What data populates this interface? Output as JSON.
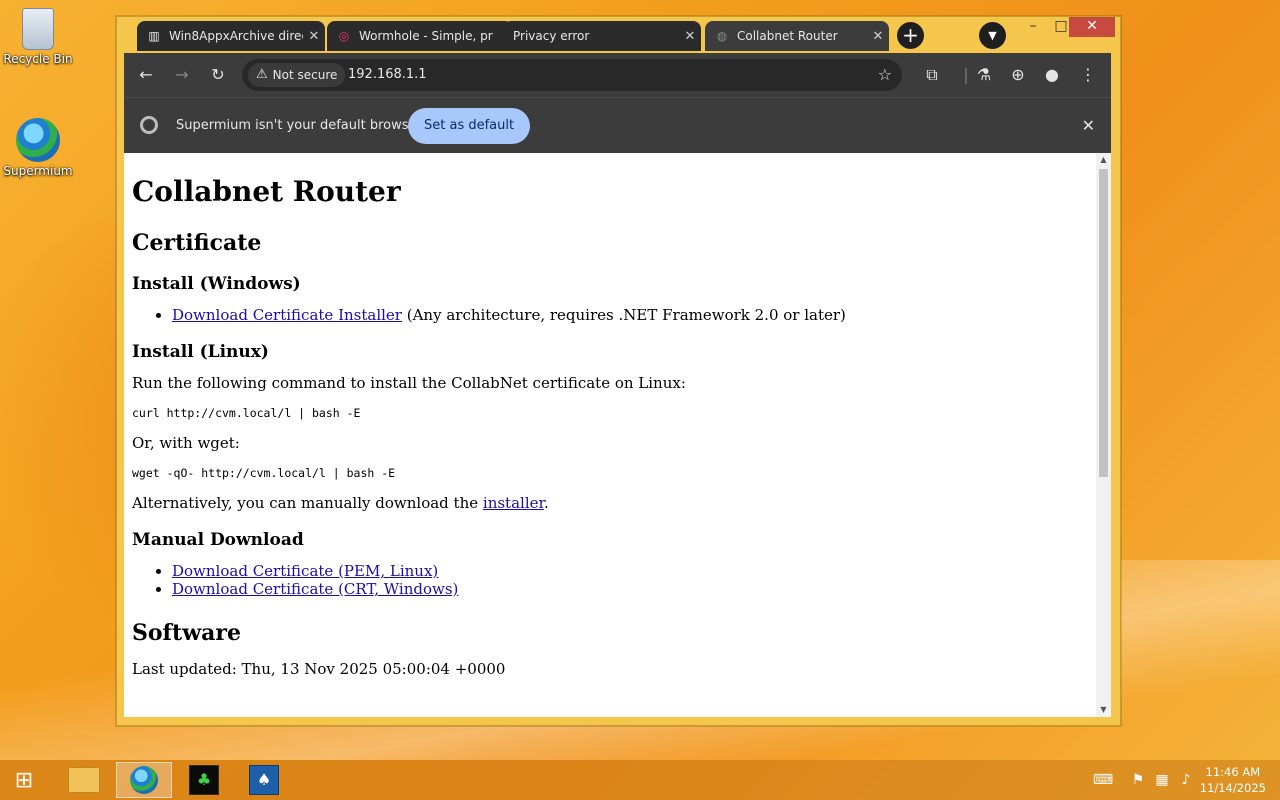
{
  "desktop": {
    "icons": [
      {
        "label": "Recycle Bin"
      },
      {
        "label": "Supermium"
      }
    ]
  },
  "browser": {
    "tabs": [
      {
        "title": "Win8AppxArchive direc",
        "favicon": "document-icon"
      },
      {
        "title": "Wormhole - Simple, pr",
        "favicon": "wormhole-icon"
      },
      {
        "title": "Privacy error",
        "favicon": "warning-icon"
      },
      {
        "title": "Collabnet Router",
        "favicon": "globe-icon",
        "active": true
      }
    ],
    "newtab_label": "+",
    "address": {
      "security_label": "Not secure",
      "url": "192.168.1.1"
    },
    "infobar": {
      "message": "Supermium isn't your default browser",
      "button": "Set as default"
    }
  },
  "page": {
    "title": "Collabnet Router",
    "section_certificate": "Certificate",
    "install_windows_heading": "Install (Windows)",
    "install_windows_link": "Download Certificate Installer",
    "install_windows_note": " (Any architecture, requires .NET Framework 2.0 or later)",
    "install_linux_heading": "Install (Linux)",
    "install_linux_text": "Run the following command to install the CollabNet certificate on Linux:",
    "curl_cmd": "curl http://cvm.local/l | bash -E",
    "or_wget": "Or, with wget:",
    "wget_cmd": "wget -qO- http://cvm.local/l | bash -E",
    "alt_text_before": "Alternatively, you can manually download the ",
    "alt_link": "installer",
    "alt_text_after": ".",
    "manual_heading": "Manual Download",
    "manual_links": [
      "Download Certificate (PEM, Linux)",
      "Download Certificate (CRT, Windows)"
    ],
    "software_heading": "Software",
    "last_updated": "Last updated: Thu, 13 Nov 2025 05:00:04 +0000"
  },
  "taskbar": {
    "time": "11:46 AM",
    "date": "11/14/2025"
  }
}
